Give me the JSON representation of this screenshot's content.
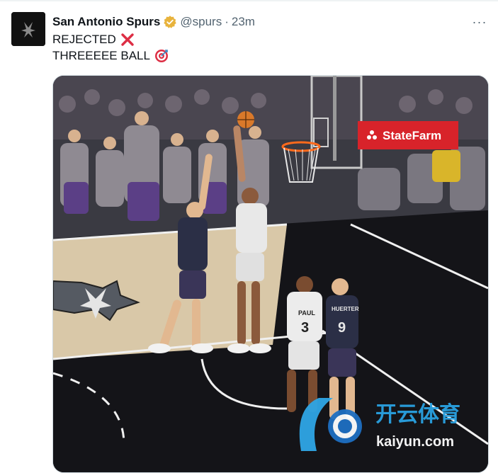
{
  "post": {
    "author_name": "San Antonio Spurs",
    "handle": "@spurs",
    "separator": "·",
    "time": "23m",
    "more_label": "···",
    "text_line1": "REJECTED",
    "text_line2": "THREEEEE BALL"
  },
  "media": {
    "sponsor_banner": "StateFarm",
    "jersey_blue_name": "HUERTER",
    "jersey_blue_number": "9",
    "jersey_white_name": "PAUL",
    "jersey_white_number": "3",
    "watermark_cn": "开云体育",
    "watermark_en": "kaiyun.com"
  },
  "colors": {
    "verified_badge": "#e8b33c",
    "reject_x": "#dd2e44",
    "banner_red": "#d8232a",
    "court_wood": "#d9c8a8"
  },
  "icons": {
    "verified": "verified-badge-icon",
    "reject": "cross-mark-icon",
    "target": "bullseye-icon",
    "more": "more-dots-icon"
  }
}
